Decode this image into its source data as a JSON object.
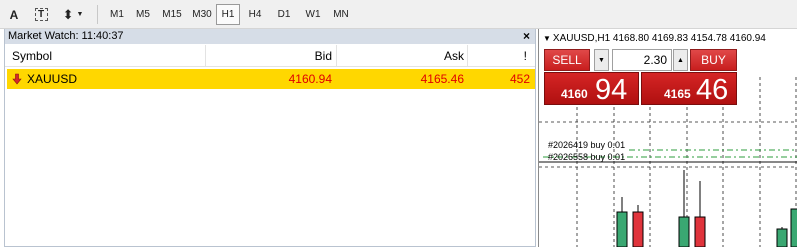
{
  "toolbar": {
    "tools": [
      {
        "name": "text-tool",
        "glyph": "A"
      },
      {
        "name": "text-label-tool",
        "glyph": "T"
      },
      {
        "name": "arrows-tool",
        "glyph": "⬍"
      }
    ],
    "timeframes": [
      "M1",
      "M5",
      "M15",
      "M30",
      "H1",
      "H4",
      "D1",
      "W1",
      "MN"
    ],
    "active_timeframe": "H1"
  },
  "market_watch": {
    "title": "Market Watch: 11:40:37",
    "close_glyph": "×",
    "columns": {
      "symbol": "Symbol",
      "bid": "Bid",
      "ask": "Ask",
      "spread": "!"
    },
    "rows": [
      {
        "symbol": "XAUUSD",
        "bid": "4160.94",
        "ask": "4165.46",
        "spread": "452"
      }
    ],
    "highlight_color": "#ffd700",
    "price_color": "#e00000"
  },
  "chart": {
    "header": "XAUUSD,H1  4168.80 4169.83 4154.78 4160.94",
    "trade_panel": {
      "sell_label": "SELL",
      "buy_label": "BUY",
      "lot": "2.30",
      "sell_price_small": "4160",
      "sell_price_big": "94",
      "buy_price_small": "4165",
      "buy_price_big": "46"
    },
    "orders": [
      "#2026419 buy 0.01",
      "#2026558 buy 0.01"
    ],
    "candle_colors": {
      "bull": "#3aa872",
      "bear": "#e0343c"
    }
  }
}
